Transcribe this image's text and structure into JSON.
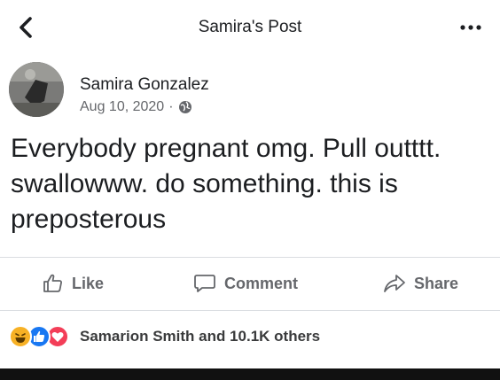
{
  "header": {
    "title": "Samira's Post"
  },
  "post": {
    "author": "Samira Gonzalez",
    "date": "Aug 10, 2020",
    "separator": "·",
    "privacy_icon": "globe-icon",
    "body_lines": [
      "Everybody pregnant omg. Pull outttt.",
      "swallowww. do something. this is",
      "preposterous"
    ]
  },
  "actions": {
    "like_label": "Like",
    "comment_label": "Comment",
    "share_label": "Share"
  },
  "reactions": {
    "icons": [
      "haha-icon",
      "like-icon",
      "love-icon"
    ],
    "summary": "Samarion Smith and 10.1K others"
  },
  "colors": {
    "text": "#1c1e21",
    "secondary": "#65676b",
    "like_blue": "#1877f2",
    "love_red": "#f33e58",
    "haha_yellow": "#f7b125",
    "divider": "#dadde1"
  }
}
